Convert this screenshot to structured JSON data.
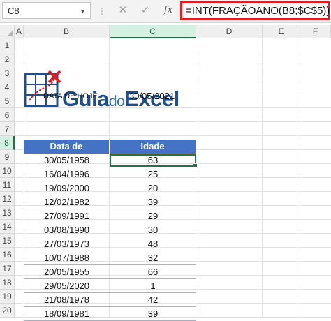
{
  "formula_bar": {
    "name_box": "C8",
    "cancel_symbol": "✕",
    "enter_symbol": "✓",
    "fx_label": "fx",
    "formula": "=INT(FRAÇÃOANO(B8;$C$5))"
  },
  "columns": [
    "A",
    "B",
    "C",
    "D",
    "E",
    "F"
  ],
  "rows": [
    "1",
    "2",
    "3",
    "4",
    "5",
    "6",
    "7",
    "8",
    "9",
    "10",
    "11",
    "12",
    "13",
    "14",
    "15",
    "16",
    "17",
    "18",
    "19",
    "20"
  ],
  "selected_cell": "C8",
  "logo": {
    "part1": "Guia",
    "part2": "do",
    "part3": "Excel"
  },
  "date_today": {
    "label": "DATA DE HOJE",
    "value": "30/05/2021"
  },
  "table": {
    "headers": [
      "Data de nascimento",
      "Idade"
    ],
    "rows": [
      [
        "30/05/1958",
        "63"
      ],
      [
        "16/04/1996",
        "25"
      ],
      [
        "19/09/2000",
        "20"
      ],
      [
        "12/02/1982",
        "39"
      ],
      [
        "27/09/1991",
        "29"
      ],
      [
        "03/08/1990",
        "30"
      ],
      [
        "27/03/1973",
        "48"
      ],
      [
        "10/07/1988",
        "32"
      ],
      [
        "20/05/1955",
        "66"
      ],
      [
        "29/05/2020",
        "1"
      ],
      [
        "21/08/1978",
        "42"
      ],
      [
        "18/09/1981",
        "39"
      ]
    ]
  },
  "colors": {
    "header_fill": "#4472c4",
    "selection": "#217346",
    "highlight": "#e31b23",
    "logo": "#1f4e8c"
  }
}
